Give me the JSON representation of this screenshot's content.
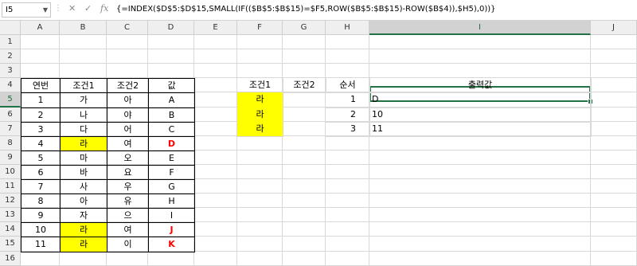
{
  "formula_bar": {
    "name_box": "I5",
    "cancel_icon": "✕",
    "enter_icon": "✓",
    "fx_label": "fx",
    "formula": "{=INDEX($D$5:$D$15,SMALL(IF(($B$5:$B$15)=$F5,ROW($B$5:$B$15)-ROW($B$4)),$H5),0))}"
  },
  "columns": [
    "A",
    "B",
    "C",
    "D",
    "E",
    "F",
    "G",
    "H",
    "I",
    "J"
  ],
  "rows": [
    "1",
    "2",
    "3",
    "4",
    "5",
    "6",
    "7",
    "8",
    "9",
    "10",
    "11",
    "12",
    "13",
    "14",
    "15",
    "16"
  ],
  "left_table": {
    "headers": [
      "연번",
      "조건1",
      "조건2",
      "값"
    ],
    "rows": [
      {
        "no": "1",
        "cond1": "가",
        "cond2": "아",
        "value": "A"
      },
      {
        "no": "2",
        "cond1": "나",
        "cond2": "야",
        "value": "B"
      },
      {
        "no": "3",
        "cond1": "다",
        "cond2": "어",
        "value": "C"
      },
      {
        "no": "4",
        "cond1": "라",
        "cond2": "여",
        "value": "D"
      },
      {
        "no": "5",
        "cond1": "마",
        "cond2": "오",
        "value": "E"
      },
      {
        "no": "6",
        "cond1": "바",
        "cond2": "요",
        "value": "F"
      },
      {
        "no": "7",
        "cond1": "사",
        "cond2": "우",
        "value": "G"
      },
      {
        "no": "8",
        "cond1": "아",
        "cond2": "유",
        "value": "H"
      },
      {
        "no": "9",
        "cond1": "자",
        "cond2": "으",
        "value": "I"
      },
      {
        "no": "10",
        "cond1": "라",
        "cond2": "여",
        "value": "J"
      },
      {
        "no": "11",
        "cond1": "라",
        "cond2": "이",
        "value": "K"
      }
    ]
  },
  "right_table": {
    "headers": [
      "조건1",
      "조건2",
      "순서",
      "출력값"
    ],
    "rows": [
      {
        "cond1": "라",
        "order": "1",
        "output": "D"
      },
      {
        "cond1": "라",
        "order": "2",
        "output": "10"
      },
      {
        "cond1": "라",
        "order": "3",
        "output": "11"
      }
    ]
  },
  "colors": {
    "highlight": "#ffff00",
    "match_text": "#ff0000",
    "selection": "#217346"
  }
}
